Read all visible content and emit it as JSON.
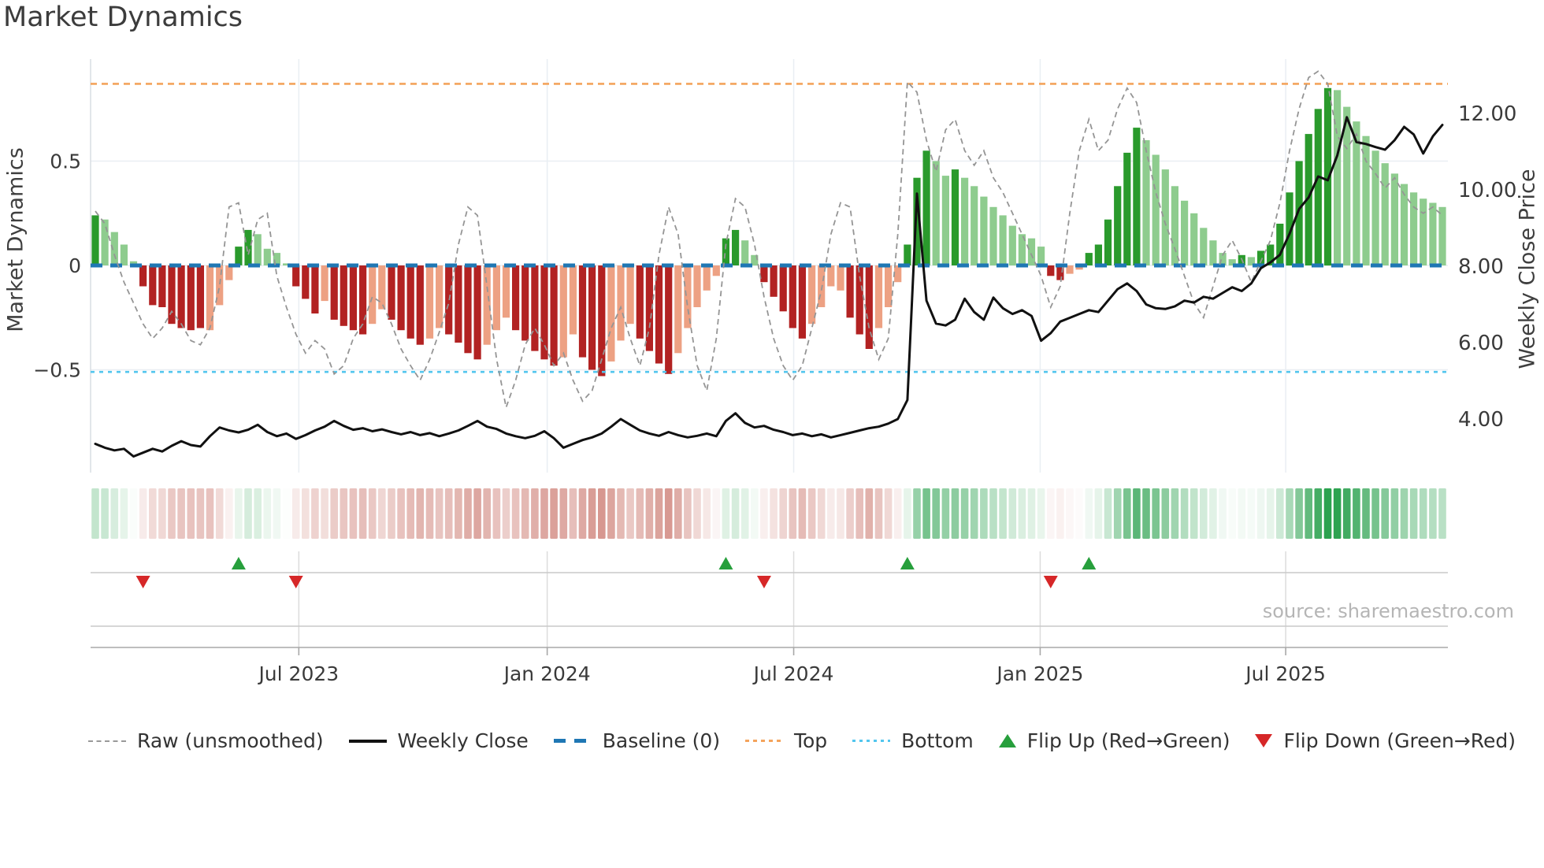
{
  "title": "Market Dynamics",
  "source": "source: sharemaestro.com",
  "left_axis": {
    "label": "Market Dynamics",
    "ticks": [
      {
        "label": "0.5",
        "value": 0.5
      },
      {
        "label": "0",
        "value": 0
      },
      {
        "label": "−0.5",
        "value": -0.5
      }
    ]
  },
  "right_axis": {
    "label": "Weekly Close Price",
    "ticks": [
      {
        "label": "12.00",
        "value": 12
      },
      {
        "label": "10.00",
        "value": 10
      },
      {
        "label": "8.00",
        "value": 8
      },
      {
        "label": "6.00",
        "value": 6
      },
      {
        "label": "4.00",
        "value": 4
      }
    ]
  },
  "x_axis": {
    "ticks": [
      {
        "label": "Jul 2023",
        "week": 21.3
      },
      {
        "label": "Jan 2024",
        "week": 47.3
      },
      {
        "label": "Jul 2024",
        "week": 73.1
      },
      {
        "label": "Jan 2025",
        "week": 98.9
      },
      {
        "label": "Jul 2025",
        "week": 124.6
      }
    ]
  },
  "legend": [
    {
      "label": "Raw (unsmoothed)",
      "marker": "dashed-line",
      "color": "#999999"
    },
    {
      "label": "Weekly Close",
      "marker": "solid-line",
      "color": "#111111"
    },
    {
      "label": "Baseline (0)",
      "marker": "long-dash-line",
      "color": "#1f77b4"
    },
    {
      "label": "Top",
      "marker": "dotted-line-orange",
      "color": "#f4a45c"
    },
    {
      "label": "Bottom",
      "marker": "dotted-line-cyan",
      "color": "#53c6ee"
    },
    {
      "label": "Flip Up (Red→Green)",
      "marker": "triangle-up",
      "color": "#279f3c"
    },
    {
      "label": "Flip Down (Green→Red)",
      "marker": "triangle-down",
      "color": "#d62728"
    }
  ],
  "colors": {
    "bar_dark_green": "#2a9a2c",
    "bar_light_green": "#8ecc8e",
    "bar_dark_red": "#b22222",
    "bar_light_red": "#eda183",
    "baseline": "#1f77b4",
    "top_line": "#f4a45c",
    "bottom_line": "#53c6ee",
    "raw_line": "#959595",
    "price_line": "#111111",
    "flip_up": "#279f3c",
    "flip_down": "#d62728",
    "heat_green": "#1f9c45",
    "heat_red": "#bb4f42",
    "grid": "#e9eef3",
    "axis": "#a8a8a8",
    "tick_text": "#3a3a3a"
  },
  "chart_data": {
    "type": "composite",
    "title": "Market Dynamics",
    "x_interval": "weekly",
    "start_date": "2023-02-04",
    "n_weeks": 142,
    "ylim_left": [
      -1.0,
      1.0
    ],
    "ylim_right": [
      2.5,
      13.4
    ],
    "reference_lines": {
      "baseline": 0,
      "top": 0.87,
      "bottom": -0.51
    },
    "flip_up_weeks": [
      15,
      66,
      85,
      104
    ],
    "flip_down_weeks": [
      5,
      21,
      70,
      100
    ],
    "shade_key": {
      "G": "dark-green",
      "g": "light-green",
      "R": "dark-red",
      "r": "light-red"
    },
    "bar_shades": "GggggRRRRRRRrrrGGggggRRRrRRRRrrRRRRrrRRRRrrrRRRRRrrRRRrrrRRRRrrrrrGGggRRRRRrrrrRRRrrrGGGggGgggggggggRRrrGGGGGGggggggggggGgGGGGGGGGgggggggggggg",
    "series": [
      {
        "name": "Market Dynamics (smoothed)",
        "type": "bar",
        "axis": "left",
        "values": [
          0.24,
          0.22,
          0.16,
          0.1,
          0.02,
          -0.1,
          -0.19,
          -0.2,
          -0.28,
          -0.3,
          -0.31,
          -0.3,
          -0.31,
          -0.19,
          -0.07,
          0.09,
          0.17,
          0.15,
          0.08,
          0.06,
          0.01,
          -0.1,
          -0.16,
          -0.23,
          -0.17,
          -0.26,
          -0.29,
          -0.31,
          -0.33,
          -0.28,
          -0.21,
          -0.26,
          -0.31,
          -0.35,
          -0.38,
          -0.35,
          -0.3,
          -0.33,
          -0.37,
          -0.42,
          -0.45,
          -0.38,
          -0.31,
          -0.25,
          -0.31,
          -0.36,
          -0.41,
          -0.45,
          -0.48,
          -0.44,
          -0.33,
          -0.44,
          -0.5,
          -0.53,
          -0.46,
          -0.36,
          -0.28,
          -0.35,
          -0.41,
          -0.47,
          -0.52,
          -0.42,
          -0.3,
          -0.2,
          -0.12,
          -0.05,
          0.13,
          0.17,
          0.12,
          0.05,
          -0.08,
          -0.15,
          -0.22,
          -0.3,
          -0.35,
          -0.28,
          -0.2,
          -0.1,
          -0.12,
          -0.25,
          -0.33,
          -0.4,
          -0.3,
          -0.2,
          -0.08,
          0.1,
          0.42,
          0.55,
          0.5,
          0.43,
          0.46,
          0.42,
          0.38,
          0.33,
          0.28,
          0.24,
          0.19,
          0.15,
          0.13,
          0.09,
          -0.05,
          -0.07,
          -0.04,
          -0.02,
          0.06,
          0.1,
          0.22,
          0.38,
          0.54,
          0.66,
          0.6,
          0.53,
          0.46,
          0.38,
          0.31,
          0.25,
          0.18,
          0.12,
          0.06,
          0.03,
          0.05,
          0.04,
          0.07,
          0.1,
          0.2,
          0.35,
          0.5,
          0.63,
          0.75,
          0.85,
          0.84,
          0.76,
          0.69,
          0.62,
          0.55,
          0.49,
          0.44,
          0.39,
          0.35,
          0.32,
          0.3,
          0.28
        ]
      },
      {
        "name": "Raw (unsmoothed)",
        "type": "line",
        "axis": "left",
        "values": [
          0.26,
          0.2,
          0.05,
          -0.08,
          -0.18,
          -0.28,
          -0.35,
          -0.3,
          -0.22,
          -0.28,
          -0.36,
          -0.38,
          -0.3,
          -0.1,
          0.28,
          0.3,
          0.05,
          0.22,
          0.25,
          -0.05,
          -0.2,
          -0.33,
          -0.42,
          -0.36,
          -0.4,
          -0.52,
          -0.48,
          -0.35,
          -0.28,
          -0.15,
          -0.18,
          -0.28,
          -0.4,
          -0.48,
          -0.55,
          -0.45,
          -0.32,
          -0.18,
          0.1,
          0.28,
          0.24,
          -0.1,
          -0.45,
          -0.68,
          -0.55,
          -0.38,
          -0.3,
          -0.38,
          -0.48,
          -0.42,
          -0.55,
          -0.65,
          -0.6,
          -0.45,
          -0.3,
          -0.2,
          -0.35,
          -0.48,
          -0.3,
          0.05,
          0.28,
          0.15,
          -0.2,
          -0.48,
          -0.6,
          -0.35,
          0.1,
          0.32,
          0.28,
          0.1,
          -0.15,
          -0.35,
          -0.48,
          -0.55,
          -0.48,
          -0.3,
          -0.12,
          0.15,
          0.3,
          0.28,
          -0.05,
          -0.3,
          -0.45,
          -0.35,
          0.15,
          0.88,
          0.83,
          0.6,
          0.45,
          0.65,
          0.7,
          0.55,
          0.48,
          0.55,
          0.42,
          0.35,
          0.25,
          0.15,
          0.05,
          -0.05,
          -0.2,
          -0.1,
          0.25,
          0.55,
          0.7,
          0.55,
          0.6,
          0.75,
          0.85,
          0.78,
          0.55,
          0.35,
          0.2,
          0.08,
          -0.05,
          -0.18,
          -0.25,
          -0.1,
          0.05,
          0.12,
          0.03,
          -0.08,
          0.02,
          0.12,
          0.3,
          0.55,
          0.75,
          0.9,
          0.93,
          0.87,
          0.62,
          0.56,
          0.63,
          0.5,
          0.44,
          0.37,
          0.42,
          0.34,
          0.28,
          0.25,
          0.28,
          0.24
        ]
      },
      {
        "name": "Weekly Close",
        "type": "line",
        "axis": "right",
        "values": [
          3.35,
          3.25,
          3.18,
          3.22,
          3.02,
          3.12,
          3.22,
          3.15,
          3.3,
          3.42,
          3.32,
          3.28,
          3.55,
          3.78,
          3.7,
          3.65,
          3.72,
          3.85,
          3.66,
          3.55,
          3.62,
          3.48,
          3.58,
          3.7,
          3.8,
          3.95,
          3.82,
          3.72,
          3.76,
          3.68,
          3.73,
          3.66,
          3.6,
          3.66,
          3.58,
          3.63,
          3.55,
          3.62,
          3.7,
          3.82,
          3.95,
          3.8,
          3.74,
          3.62,
          3.55,
          3.5,
          3.56,
          3.68,
          3.5,
          3.25,
          3.35,
          3.45,
          3.52,
          3.62,
          3.8,
          4.0,
          3.85,
          3.7,
          3.62,
          3.56,
          3.66,
          3.58,
          3.52,
          3.56,
          3.62,
          3.55,
          3.95,
          4.15,
          3.9,
          3.78,
          3.82,
          3.72,
          3.66,
          3.58,
          3.62,
          3.55,
          3.6,
          3.52,
          3.58,
          3.64,
          3.7,
          3.76,
          3.8,
          3.88,
          4.0,
          4.5,
          9.9,
          7.1,
          6.5,
          6.45,
          6.6,
          7.15,
          6.8,
          6.6,
          7.18,
          6.9,
          6.75,
          6.85,
          6.7,
          6.05,
          6.25,
          6.55,
          6.65,
          6.75,
          6.85,
          6.8,
          7.1,
          7.4,
          7.55,
          7.35,
          7.0,
          6.9,
          6.88,
          6.95,
          7.1,
          7.05,
          7.2,
          7.15,
          7.3,
          7.45,
          7.35,
          7.55,
          7.95,
          8.1,
          8.3,
          8.85,
          9.5,
          9.8,
          10.35,
          10.25,
          10.9,
          11.9,
          11.25,
          11.2,
          11.12,
          11.05,
          11.3,
          11.65,
          11.45,
          10.95,
          11.4,
          11.7
        ]
      }
    ],
    "heatmap": {
      "description": "weekly strip colored by smoothed bar value, white→green positive, white→red negative"
    }
  }
}
